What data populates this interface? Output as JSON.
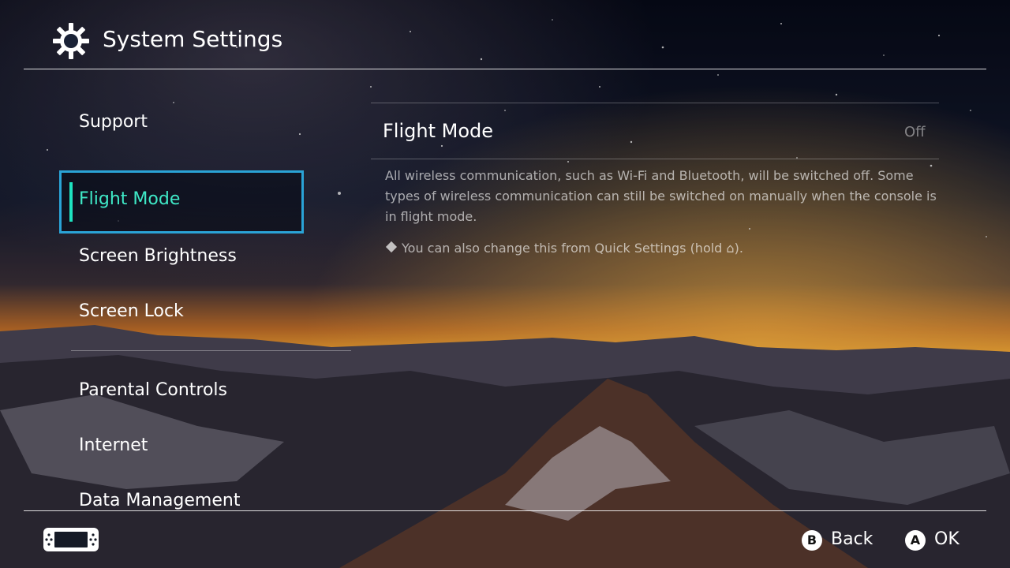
{
  "header": {
    "title": "System Settings",
    "icon": "gear-icon"
  },
  "sidebar": {
    "items": [
      {
        "label": "Support"
      },
      {
        "label": "Flight Mode",
        "selected": true
      },
      {
        "label": "Screen Brightness"
      },
      {
        "label": "Screen Lock"
      },
      {
        "label": "Parental Controls"
      },
      {
        "label": "Internet"
      },
      {
        "label": "Data Management"
      }
    ]
  },
  "detail": {
    "title": "Flight Mode",
    "value": "Off",
    "description": "All wireless communication, such as Wi-Fi and Bluetooth, will be switched off. Some types of wireless communication can still be switched on manually when the console is in flight mode.",
    "note": "You can also change this from Quick Settings (hold ⌂)."
  },
  "footer": {
    "back_button": "B",
    "back_label": "Back",
    "ok_button": "A",
    "ok_label": "OK"
  },
  "colors": {
    "accent": "#1ee3c0",
    "selection_border": "#2aa3d6"
  }
}
